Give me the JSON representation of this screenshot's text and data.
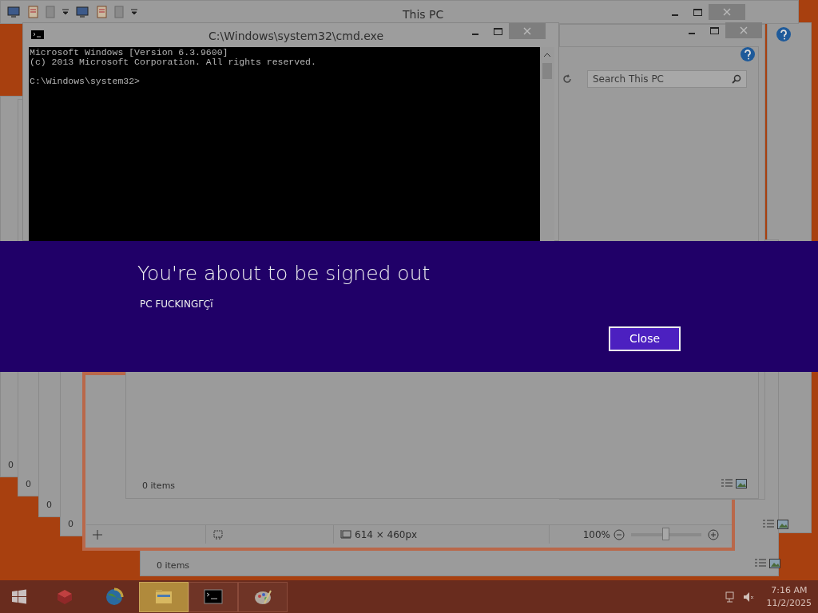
{
  "stacked_windows": [
    {
      "status": "0"
    },
    {
      "status": "0"
    },
    {
      "status": "0"
    },
    {
      "status": "0"
    }
  ],
  "back_explorer": {
    "status": "0 items"
  },
  "this_pc_window": {
    "title": "This PC"
  },
  "explorer_window": {
    "search": {
      "placeholder": "Search This PC"
    },
    "status": "0 items"
  },
  "paint_window": {
    "dimensions": "614 × 460px",
    "zoom": "100%",
    "zoom_slider": {
      "level": 0.5
    }
  },
  "cmd_window": {
    "title": "C:\\Windows\\system32\\cmd.exe",
    "lines": [
      "Microsoft Windows [Version 6.3.9600]",
      "(c) 2013 Microsoft Corporation. All rights reserved.",
      "C:\\Windows\\system32>"
    ]
  },
  "dialog": {
    "title": "You're about to be signed out",
    "message": "PC FUCKINGΓÇï",
    "button": "Close"
  },
  "taskbar": {
    "items": [
      {
        "kind": "start",
        "selected": false
      },
      {
        "kind": "box",
        "selected": false
      },
      {
        "kind": "globe",
        "selected": false
      },
      {
        "kind": "folder",
        "selected": true
      },
      {
        "kind": "console",
        "selected": false
      },
      {
        "kind": "paint",
        "selected": false
      }
    ],
    "clock": {
      "time": "7:16 AM",
      "date": "11/2/2025"
    }
  }
}
